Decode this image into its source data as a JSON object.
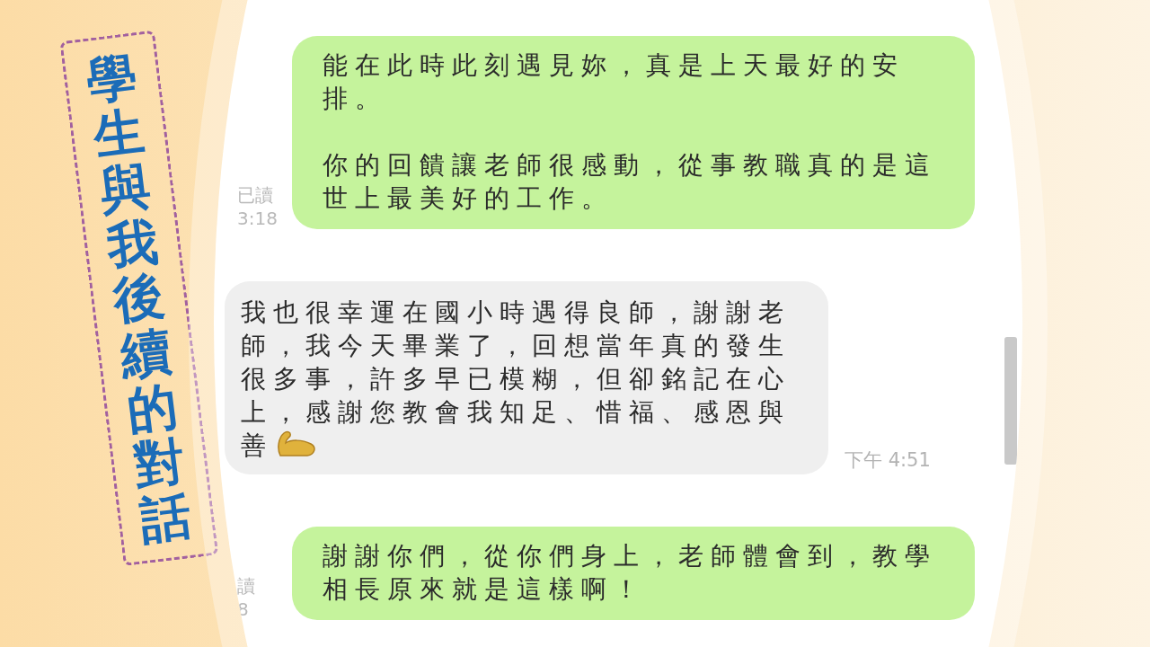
{
  "title": "學生與我後續的對話",
  "messages": [
    {
      "kind": "sent",
      "paragraphs": [
        "能在此時此刻遇見妳，真是上天最好的安排。",
        "你的回饋讓老師很感動，從事教職真的是這世上最美好的工作。"
      ],
      "status": "已讀",
      "time": "3:18"
    },
    {
      "kind": "received",
      "paragraphs": [
        "我也很幸運在國小時遇得良師，謝謝老師，我今天畢業了，回想當年真的發生很多事，許多早已模糊，但卻銘記在心上，感謝您教會我知足、惜福、感恩與善"
      ],
      "time": "下午 4:51"
    },
    {
      "kind": "sent",
      "paragraphs": [
        "謝謝你們，從你們身上，老師體會到，教學相長原來就是這樣啊！"
      ],
      "status": "讀",
      "time": "8"
    }
  ]
}
